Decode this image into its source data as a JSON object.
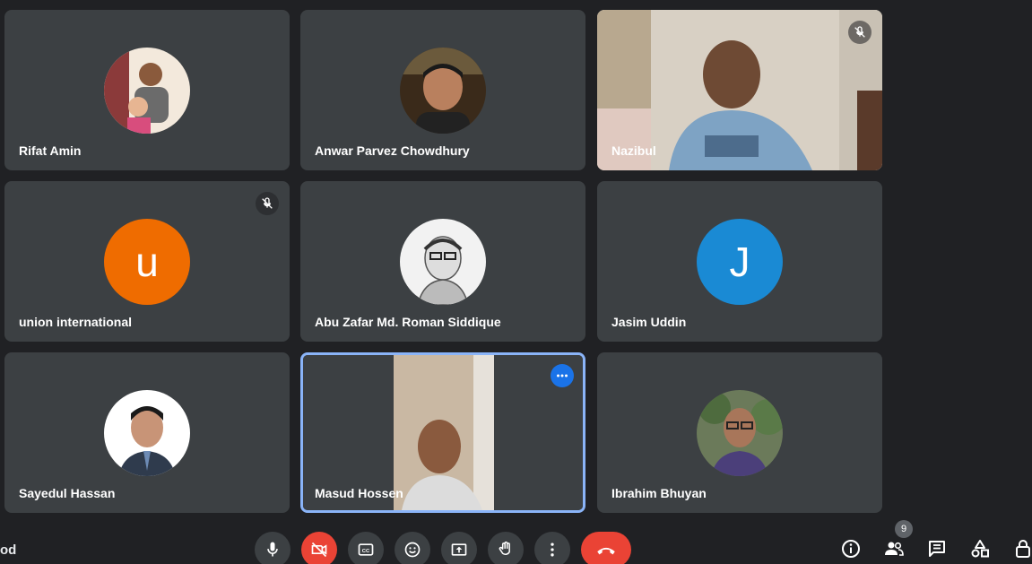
{
  "meeting": {
    "name": "od"
  },
  "participants": [
    {
      "name": "Rifat Amin"
    },
    {
      "name": "Anwar Parvez Chowdhury"
    },
    {
      "name": "Nazibul"
    },
    {
      "name": "union international",
      "initial": "u",
      "color": "#ef6c00"
    },
    {
      "name": "Abu Zafar Md. Roman Siddique"
    },
    {
      "name": "Jasim Uddin",
      "initial": "J",
      "color": "#1a8ad4"
    },
    {
      "name": "Sayedul Hassan"
    },
    {
      "name": "Masud Hossen"
    },
    {
      "name": "Ibrahim Bhuyan"
    }
  ],
  "people_count": "9",
  "colors": {
    "background": "#202124",
    "tile": "#3c4043",
    "active_border": "#8ab4f8",
    "danger": "#ea4335"
  },
  "controls": {
    "icons": [
      "mic-icon",
      "camera-off-icon",
      "captions-icon",
      "emoji-icon",
      "present-icon",
      "raise-hand-icon",
      "more-options-icon",
      "end-call-icon"
    ],
    "side_icons": [
      "info-icon",
      "people-icon",
      "chat-icon",
      "activities-icon",
      "lock-icon"
    ]
  }
}
